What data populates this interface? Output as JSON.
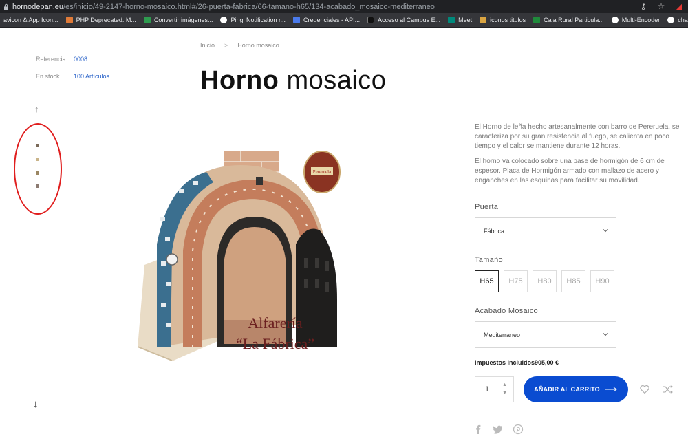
{
  "browser": {
    "url_domain": "hornodepan.eu",
    "url_path": "/es/inicio/49-2147-horno-mosaico.html#/26-puerta-fabrica/66-tamano-h65/134-acabado_mosaico-mediterraneo",
    "bookmarks": [
      {
        "label": "avicon & App Icon...",
        "color": "#5b8def"
      },
      {
        "label": "PHP Deprecated: M...",
        "color": "#e07b39"
      },
      {
        "label": "Convertir imágenes...",
        "color": "#2e9b4f"
      },
      {
        "label": "Pingl Notification r...",
        "color": "#ffffff"
      },
      {
        "label": "Credenciales - API...",
        "color": "#4b7bec"
      },
      {
        "label": "Acceso al Campus E...",
        "color": "#222222"
      },
      {
        "label": "Meet",
        "color": "#00897b"
      },
      {
        "label": "iconos titulos",
        "color": "#d9a441"
      },
      {
        "label": "Caja Rural Particula...",
        "color": "#1f8a3b"
      },
      {
        "label": "Multi-Encoder",
        "color": "#ffffff"
      },
      {
        "label": "chamilo-lms/plugin...",
        "color": "#ffffff"
      }
    ]
  },
  "product_info": {
    "reference_label": "Referencia",
    "reference_value": "0008",
    "stock_label": "En stock",
    "stock_value": "100 Artículos"
  },
  "breadcrumb": {
    "home": "Inicio",
    "separator": ">",
    "current": "Horno mosaico"
  },
  "title": {
    "bold": "Horno",
    "light": "mosaico"
  },
  "product_image": {
    "brand_line1": "Alfarería",
    "brand_line2": "“La Fábrica”",
    "seal_text": "Pereruela"
  },
  "description": {
    "p1": "El Horno de leña hecho artesanalmente con barro de Pereruela, se caracteriza por su gran resistencia al fuego, se calienta en poco tiempo y el calor se mantiene durante 12 horas.",
    "p2": "El horno va colocado sobre una base de hormigón de 6 cm de espesor. Placa de Hormigón armado con mallazo de acero y enganches en las esquinas para facilitar su movilidad."
  },
  "options": {
    "door_label": "Puerta",
    "door_value": "Fábrica",
    "size_label": "Tamaño",
    "sizes": [
      "H65",
      "H75",
      "H80",
      "H85",
      "H90"
    ],
    "selected_size": "H65",
    "finish_label": "Acabado Mosaico",
    "finish_value": "Mediterraneo"
  },
  "price": {
    "tax_label": "Impuestos incluidos",
    "amount": "905,00 €"
  },
  "cart": {
    "quantity": "1",
    "add_label": "AÑADIR AL CARRITO"
  },
  "colors": {
    "accent": "#0a4cd1",
    "link": "#2a63c9",
    "highlight_circle": "#e01e1e"
  }
}
